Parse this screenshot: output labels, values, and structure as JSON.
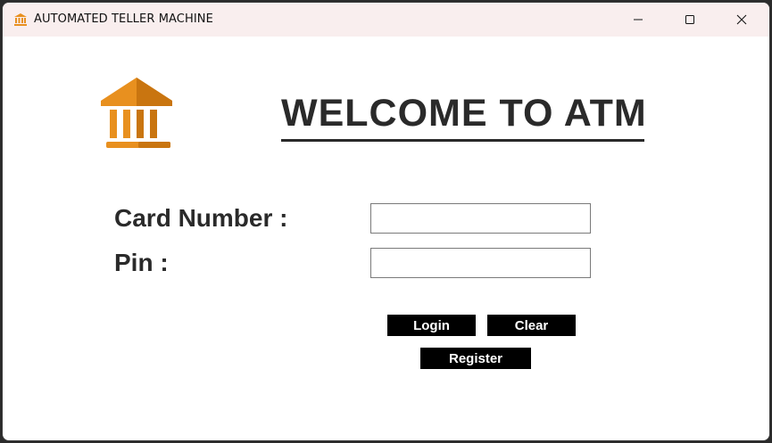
{
  "window": {
    "title": "AUTOMATED TELLER MACHINE",
    "app_icon": "bank-icon",
    "controls": {
      "minimize_icon": "minimize-icon",
      "maximize_icon": "maximize-icon",
      "close_icon": "close-icon"
    }
  },
  "header": {
    "logo_icon": "bank-building-icon",
    "welcome_text": "WELCOME TO ATM"
  },
  "form": {
    "card_label": "Card Number :",
    "card_value": "",
    "pin_label": "Pin :",
    "pin_value": ""
  },
  "buttons": {
    "login": "Login",
    "clear": "Clear",
    "register": "Register"
  },
  "colors": {
    "logo_orange": "#e8901f",
    "logo_orange_dark": "#c97510",
    "button_bg": "#000000",
    "button_text": "#ffffff",
    "text_dark": "#2a2a2a",
    "titlebar_bg": "#f9eeee"
  }
}
